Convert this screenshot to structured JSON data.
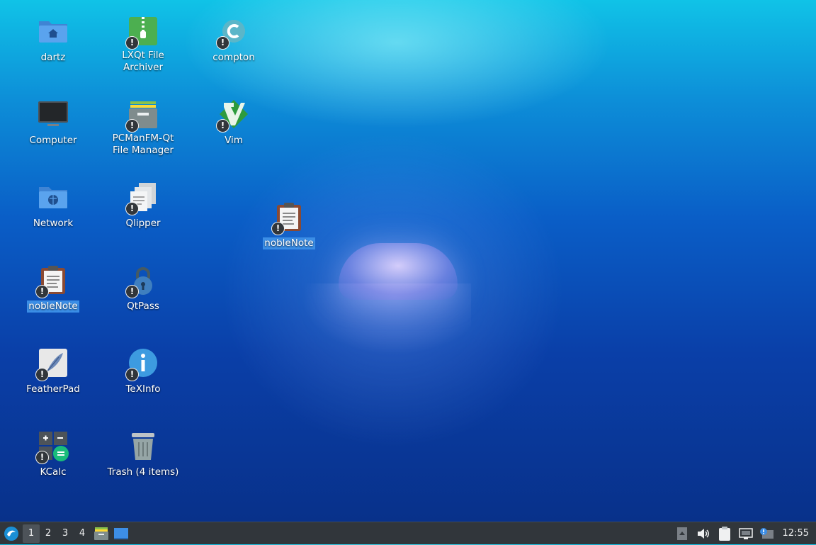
{
  "desktop": {
    "icons": [
      {
        "label": "dartz"
      },
      {
        "label": "Computer"
      },
      {
        "label": "Network"
      },
      {
        "label": "nobleNote"
      },
      {
        "label": "FeatherPad"
      },
      {
        "label": "KCalc"
      },
      {
        "label": "LXQt File Archiver"
      },
      {
        "label": "PCManFM-Qt File Manager"
      },
      {
        "label": "Qlipper"
      },
      {
        "label": "QtPass"
      },
      {
        "label": "TeXInfo"
      },
      {
        "label": "Trash (4 items)"
      },
      {
        "label": "compton"
      },
      {
        "label": "Vim"
      }
    ],
    "dragged_icon": {
      "label": "nobleNote"
    },
    "badge_glyph": "!"
  },
  "taskbar": {
    "desktops": [
      "1",
      "2",
      "3",
      "4"
    ],
    "active_desktop": "1",
    "clock": "12:55",
    "accent_color": "#3b8ee6"
  }
}
